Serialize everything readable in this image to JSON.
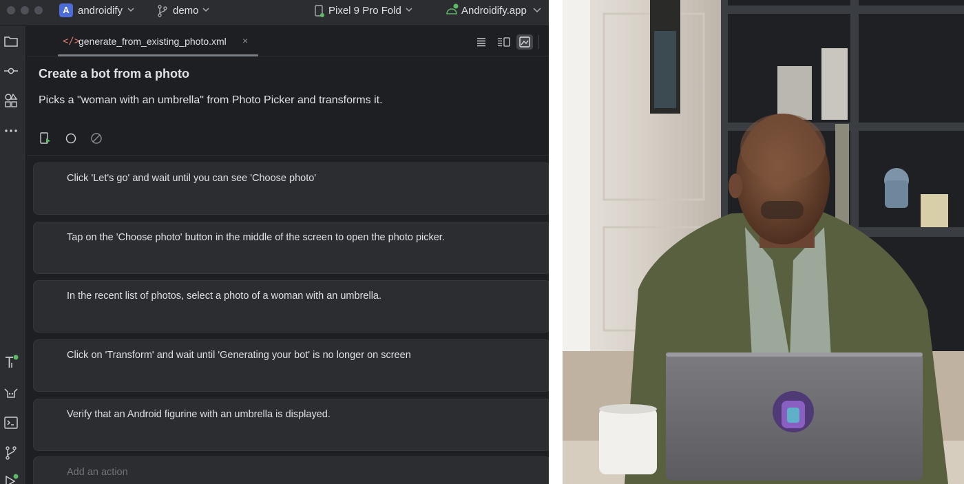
{
  "titlebar": {
    "project_badge": "A",
    "project_name": "androidify",
    "branch_name": "demo",
    "device_name": "Pixel 9 Pro Fold",
    "run_config": "Androidify.app"
  },
  "editor": {
    "tab_label": "generate_from_existing_photo.xml",
    "tab_icon": "</>",
    "close_glyph": "×"
  },
  "journey": {
    "title": "Create a bot from a photo",
    "description": "Picks a \"woman with an umbrella\" from Photo Picker and transforms it.",
    "steps": [
      "Click 'Let's go' and wait until you can see 'Choose photo'",
      "Tap on the 'Choose photo' button in the middle of the screen to open the photo picker.",
      "In the recent list of photos, select a photo of a woman with an umbrella.",
      "Click on 'Transform' and wait until 'Generating your bot' is no longer on screen",
      "Verify that an Android figurine with an umbrella is displayed."
    ],
    "add_action_placeholder": "Add an action"
  },
  "colors": {
    "accent_blue": "#4e6cd8",
    "status_green": "#5fb865",
    "code_icon_red": "#e07a6a"
  }
}
